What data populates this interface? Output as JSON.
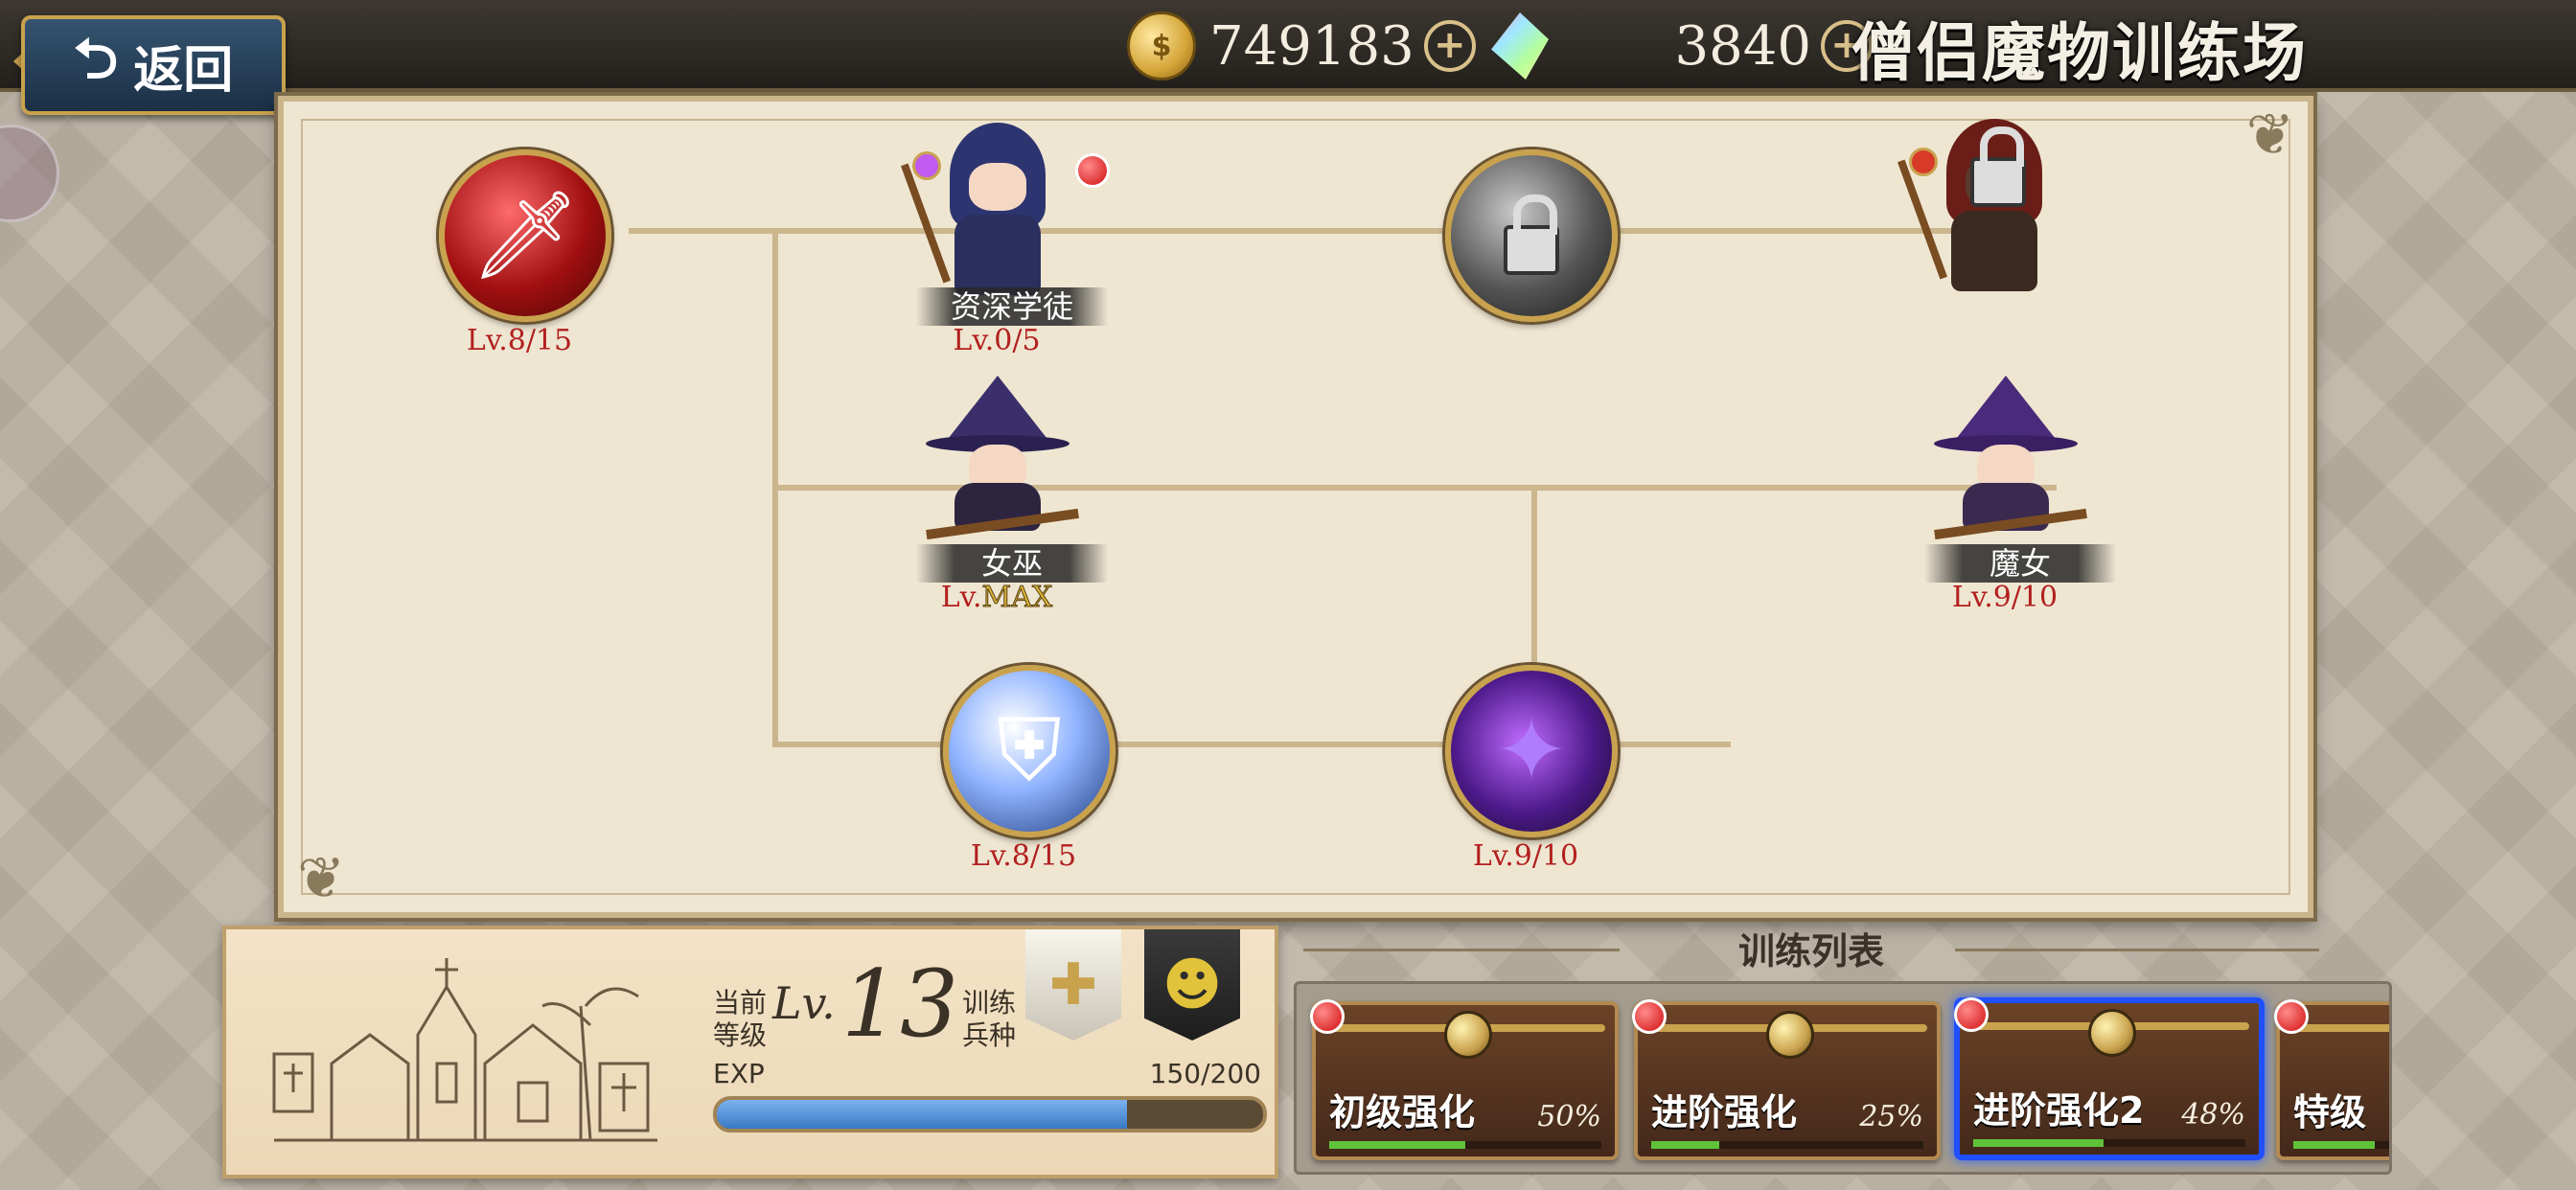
{
  "header": {
    "back_label": "返回",
    "gold": "749183",
    "crystals": "3840",
    "title": "僧侣魔物训练场"
  },
  "tree": {
    "nodes": [
      {
        "id": "sword",
        "level": "Lv.8/15"
      },
      {
        "id": "senior-apprentice",
        "name": "资深学徒",
        "level": "Lv.0/5"
      },
      {
        "id": "locked-skill",
        "level": ""
      },
      {
        "id": "locked-unit",
        "level": ""
      },
      {
        "id": "witch",
        "name": "女巫",
        "level_prefix": "Lv.",
        "level_max": "MAX"
      },
      {
        "id": "sorceress",
        "name": "魔女",
        "level": "Lv.9/10"
      },
      {
        "id": "shield",
        "level": "Lv.8/15"
      },
      {
        "id": "shadow",
        "level": "Lv.9/10"
      }
    ]
  },
  "info": {
    "current_level_label_1": "当前",
    "current_level_label_2": "等级",
    "lv_text": "Lv.",
    "level": "13",
    "train_label_1": "训练",
    "train_label_2": "兵种",
    "exp_label": "EXP",
    "exp_value": "150/200",
    "exp_progress": 0.75
  },
  "training_list": {
    "title": "训练列表",
    "cards": [
      {
        "name": "初级强化",
        "percent": "50%",
        "progress": 0.5
      },
      {
        "name": "进阶强化",
        "percent": "25%",
        "progress": 0.25
      },
      {
        "name": "进阶强化2",
        "percent": "48%",
        "progress": 0.48,
        "selected": true
      },
      {
        "name": "特级",
        "percent": "",
        "progress": 0.3
      }
    ]
  },
  "colors": {
    "accent_gold": "#c9a24e",
    "level_red": "#b2201e",
    "selected_blue": "#1f4fff",
    "exp_blue": "#3979c5"
  }
}
